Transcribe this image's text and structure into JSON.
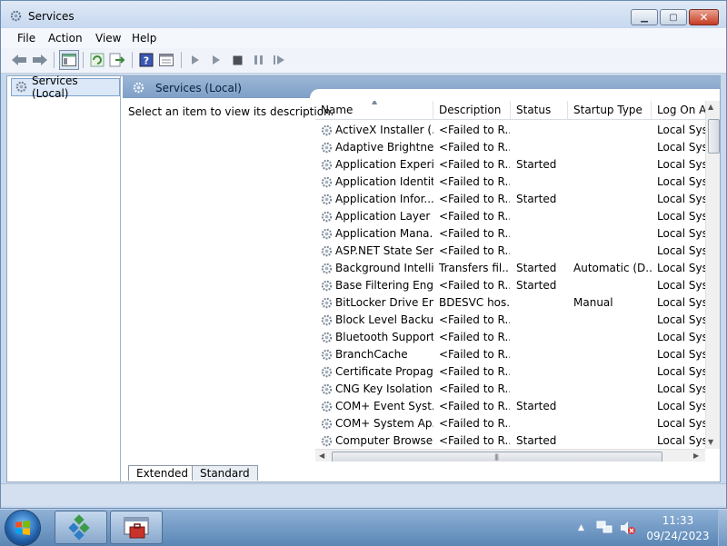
{
  "window": {
    "title": "Services"
  },
  "menu": {
    "items": [
      "File",
      "Action",
      "View",
      "Help"
    ]
  },
  "tree": {
    "root_label": "Services (Local)"
  },
  "panel": {
    "header": "Services (Local)",
    "description": "Select an item to view its description."
  },
  "list": {
    "columns": {
      "name": "Name",
      "description": "Description",
      "status": "Status",
      "startup": "Startup Type",
      "logon": "Log On A"
    },
    "rows": [
      {
        "name": "ActiveX Installer (...",
        "description": "<Failed to R...",
        "status": "",
        "startup": "",
        "logon": "Local Syst"
      },
      {
        "name": "Adaptive Brightness",
        "description": "<Failed to R...",
        "status": "",
        "startup": "",
        "logon": "Local Syst"
      },
      {
        "name": "Application Experi...",
        "description": "<Failed to R...",
        "status": "Started",
        "startup": "",
        "logon": "Local Syst"
      },
      {
        "name": "Application Identity",
        "description": "<Failed to R...",
        "status": "",
        "startup": "",
        "logon": "Local Syst"
      },
      {
        "name": "Application Infor...",
        "description": "<Failed to R...",
        "status": "Started",
        "startup": "",
        "logon": "Local Syst"
      },
      {
        "name": "Application Layer ...",
        "description": "<Failed to R...",
        "status": "",
        "startup": "",
        "logon": "Local Syst"
      },
      {
        "name": "Application Mana...",
        "description": "<Failed to R...",
        "status": "",
        "startup": "",
        "logon": "Local Syst"
      },
      {
        "name": "ASP.NET State Ser...",
        "description": "<Failed to R...",
        "status": "",
        "startup": "",
        "logon": "Local Syst"
      },
      {
        "name": "Background Intelli...",
        "description": "Transfers fil...",
        "status": "Started",
        "startup": "Automatic (D...",
        "logon": "Local Syst"
      },
      {
        "name": "Base Filtering Engi...",
        "description": "<Failed to R...",
        "status": "Started",
        "startup": "",
        "logon": "Local Syst"
      },
      {
        "name": "BitLocker Drive En...",
        "description": "BDESVC hos...",
        "status": "",
        "startup": "Manual",
        "logon": "Local Syst"
      },
      {
        "name": "Block Level Backu...",
        "description": "<Failed to R...",
        "status": "",
        "startup": "",
        "logon": "Local Syst"
      },
      {
        "name": "Bluetooth Support...",
        "description": "<Failed to R...",
        "status": "",
        "startup": "",
        "logon": "Local Syst"
      },
      {
        "name": "BranchCache",
        "description": "<Failed to R...",
        "status": "",
        "startup": "",
        "logon": "Local Syst"
      },
      {
        "name": "Certificate Propag...",
        "description": "<Failed to R...",
        "status": "",
        "startup": "",
        "logon": "Local Syst"
      },
      {
        "name": "CNG Key Isolation",
        "description": "<Failed to R...",
        "status": "",
        "startup": "",
        "logon": "Local Syst"
      },
      {
        "name": "COM+ Event Syst...",
        "description": "<Failed to R...",
        "status": "Started",
        "startup": "",
        "logon": "Local Syst"
      },
      {
        "name": "COM+ System Ap...",
        "description": "<Failed to R...",
        "status": "",
        "startup": "",
        "logon": "Local Syst"
      },
      {
        "name": "Computer Browser",
        "description": "<Failed to R...",
        "status": "Started",
        "startup": "",
        "logon": "Local Syst"
      }
    ]
  },
  "tabs": {
    "extended": "Extended",
    "standard": "Standard"
  },
  "taskbar": {
    "time": "11:33",
    "date": "09/24/2023"
  },
  "colors": {
    "selection": "#dce8f7",
    "header_band": "#8aa9cd",
    "taskbar": "#6f97c4"
  }
}
